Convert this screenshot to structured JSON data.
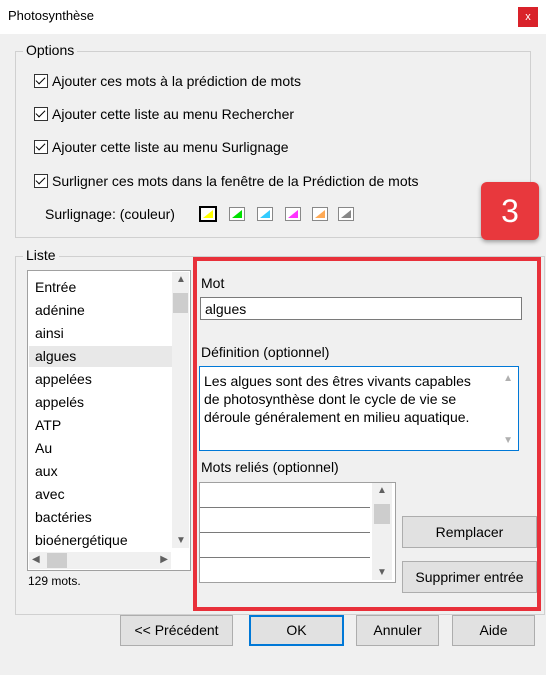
{
  "window": {
    "title": "Photosynthèse",
    "close_label": "x"
  },
  "options": {
    "legend": "Options",
    "checkboxes": [
      {
        "label": "Ajouter ces mots à la prédiction de mots",
        "checked": true
      },
      {
        "label": "Ajouter cette liste au menu Rechercher",
        "checked": true
      },
      {
        "label": "Ajouter cette liste au menu Surlignage",
        "checked": true
      },
      {
        "label": "Surligner ces mots dans la fenêtre de la Prédiction de mots",
        "checked": true
      }
    ],
    "highlight_label": "Surlignage: (couleur)",
    "highlight_colors": [
      "#ffff00",
      "#00e000",
      "#33ccff",
      "#ff33ff",
      "#ffaa55",
      "#888888"
    ]
  },
  "liste": {
    "legend": "Liste",
    "items": [
      "Entrée",
      "adénine",
      "ainsi",
      "algues",
      "appelées",
      "appelés",
      "ATP",
      "Au",
      "aux",
      "avec",
      "bactéries",
      "bioénergétique"
    ],
    "selected": "algues",
    "count": "129 mots."
  },
  "editor": {
    "mot_label": "Mot",
    "mot_value": "algues",
    "definition_label": "Définition (optionnel)",
    "definition_value": "Les algues sont des êtres vivants capables de photosynthèse dont le cycle de vie se déroule généralement en milieu aquatique.",
    "related_label": "Mots reliés (optionnel)",
    "replace_button": "Remplacer",
    "delete_button": "Supprimer entrée"
  },
  "annotation": {
    "badge": "3",
    "color": "#e8303a"
  },
  "buttons": {
    "previous": "<< Précédent",
    "ok": "OK",
    "cancel": "Annuler",
    "help": "Aide"
  }
}
